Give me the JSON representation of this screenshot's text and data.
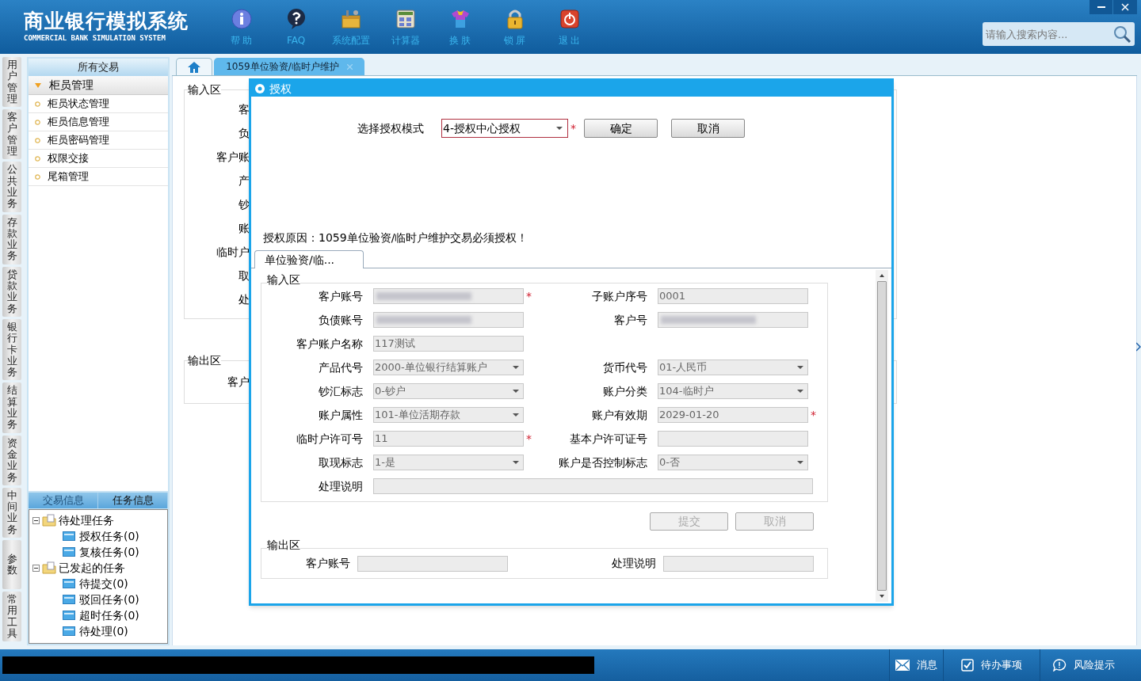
{
  "app": {
    "title": "商业银行模拟系统",
    "subtitle": "COMMERCIAL BANK SIMULATION SYSTEM"
  },
  "toolbar": [
    {
      "label": "帮 助"
    },
    {
      "label": "FAQ"
    },
    {
      "label": "系统配置"
    },
    {
      "label": "计算器"
    },
    {
      "label": "换 肤"
    },
    {
      "label": "锁 屏"
    },
    {
      "label": "退 出"
    }
  ],
  "search": {
    "placeholder": "请输入搜索内容..."
  },
  "side_tabs": [
    {
      "label": "用户管理"
    },
    {
      "label": "客户管理"
    },
    {
      "label": "公共业务"
    },
    {
      "label": "存款业务"
    },
    {
      "label": "贷款业务"
    },
    {
      "label": "银行卡业务"
    },
    {
      "label": "结算业务"
    },
    {
      "label": "资金业务"
    },
    {
      "label": "中间业务"
    },
    {
      "label": "参数"
    },
    {
      "label": "常用工具"
    }
  ],
  "sidebar": {
    "title": "所有交易",
    "group": {
      "label": "柜员管理",
      "expanded": true,
      "items": [
        "柜员状态管理",
        "柜员信息管理",
        "柜员密码管理",
        "权限交接",
        "尾箱管理"
      ]
    }
  },
  "task_panel": {
    "tabs": [
      {
        "label": "交易信息",
        "selected": false
      },
      {
        "label": "任务信息",
        "selected": true
      }
    ],
    "tree": [
      {
        "label": "待处理任务",
        "expanded": true,
        "children": [
          {
            "label": "授权任务(0)"
          },
          {
            "label": "复核任务(0)"
          }
        ]
      },
      {
        "label": "已发起的任务",
        "expanded": true,
        "children": [
          {
            "label": "待提交(0)"
          },
          {
            "label": "驳回任务(0)"
          },
          {
            "label": "超时任务(0)"
          },
          {
            "label": "待处理(0)"
          }
        ]
      }
    ]
  },
  "tabs": [
    {
      "kind": "home",
      "selected": false
    },
    {
      "kind": "page",
      "label": "1059单位验资/临时户维护",
      "selected": true
    }
  ],
  "background_form": {
    "input_title": "输入区",
    "labels": [
      "客",
      "负",
      "客户账",
      "产",
      "钞",
      "账",
      "临时户",
      "取",
      "处"
    ],
    "output_title": "输出区",
    "output_labels": [
      "客户"
    ]
  },
  "dialog": {
    "title": "授权",
    "mode_label": "选择授权模式",
    "mode_value": "4-授权中心授权",
    "mode_required_mark": "*",
    "buttons": [
      "确定",
      "取消"
    ],
    "reason": "授权原因：1059单位验资/临时户维护交易必须授权！",
    "tab": "单位验资/临...",
    "input_title": "输入区",
    "rows": [
      [
        {
          "label": "客户账号",
          "kind": "text",
          "blurred": true,
          "required_mark": "*"
        },
        {
          "label": "子账户序号",
          "kind": "text",
          "value": "0001"
        }
      ],
      [
        {
          "label": "负债账号",
          "kind": "text",
          "blurred": true
        },
        {
          "label": "客户号",
          "kind": "text",
          "blurred": true
        }
      ],
      [
        {
          "label": "客户账户名称",
          "kind": "text",
          "value": "117测试"
        }
      ],
      [
        {
          "label": "产品代号",
          "kind": "select",
          "value": "2000-单位银行结算账户"
        },
        {
          "label": "货币代号",
          "kind": "select",
          "value": "01-人民币"
        }
      ],
      [
        {
          "label": "钞汇标志",
          "kind": "select",
          "value": "0-钞户"
        },
        {
          "label": "账户分类",
          "kind": "select",
          "value": "104-临时户"
        }
      ],
      [
        {
          "label": "账户属性",
          "kind": "select",
          "value": "101-单位活期存款"
        },
        {
          "label": "账户有效期",
          "kind": "text",
          "value": "2029-01-20",
          "required_mark": "*"
        }
      ],
      [
        {
          "label": "临时户许可号",
          "kind": "text",
          "value": "11",
          "required_mark": "*"
        },
        {
          "label": "基本户许可证号",
          "kind": "text"
        }
      ],
      [
        {
          "label": "取现标志",
          "kind": "select",
          "value": "1-是"
        },
        {
          "label": "账户是否控制标志",
          "kind": "select",
          "value": "0-否"
        }
      ],
      [
        {
          "label": "处理说明",
          "kind": "wide"
        }
      ]
    ],
    "actions": [
      {
        "label": "提交",
        "disabled": true
      },
      {
        "label": "取消",
        "disabled": true
      }
    ],
    "output_title": "输出区",
    "output_fields": [
      {
        "label": "客户账号"
      },
      {
        "label": "处理说明"
      }
    ]
  },
  "status_bar": [
    {
      "label": "消息"
    },
    {
      "label": "待办事项"
    },
    {
      "label": "风险提示"
    }
  ]
}
